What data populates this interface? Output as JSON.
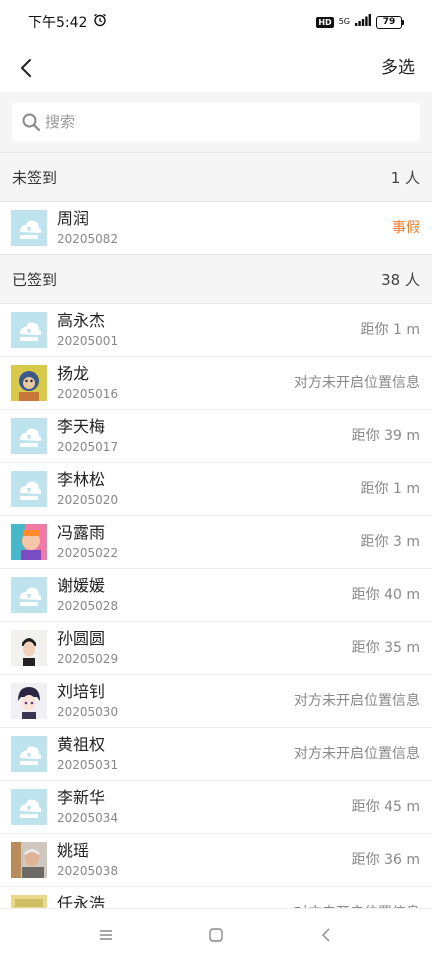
{
  "status_bar": {
    "time": "下午5:42",
    "network": "5G",
    "hd": "HD",
    "battery": "79"
  },
  "nav": {
    "action_label": "多选"
  },
  "search": {
    "placeholder": "搜索"
  },
  "sections": [
    {
      "title": "未签到",
      "count": "1 人",
      "students": [
        {
          "name": "周润",
          "id": "20205082",
          "status": "事假",
          "avatar": "default-cloud-avatar",
          "status_color": "#f07b2c"
        }
      ]
    },
    {
      "title": "已签到",
      "count": "38 人",
      "students": [
        {
          "name": "高永杰",
          "id": "20205001",
          "status": "距你 1 m",
          "avatar": "default-cloud-avatar"
        },
        {
          "name": "扬龙",
          "id": "20205016",
          "status": "对方未开启位置信息",
          "avatar": "monkey-photo-avatar"
        },
        {
          "name": "李天梅",
          "id": "20205017",
          "status": "距你 39 m",
          "avatar": "default-cloud-avatar"
        },
        {
          "name": "李林松",
          "id": "20205020",
          "status": "距你 1 m",
          "avatar": "default-cloud-avatar"
        },
        {
          "name": "冯露雨",
          "id": "20205022",
          "status": "距你 3 m",
          "avatar": "colorful-portrait-avatar"
        },
        {
          "name": "谢媛媛",
          "id": "20205028",
          "status": "距你 40 m",
          "avatar": "default-cloud-avatar"
        },
        {
          "name": "孙圆圆",
          "id": "20205029",
          "status": "距你 35 m",
          "avatar": "man-portrait-avatar"
        },
        {
          "name": "刘培钊",
          "id": "20205030",
          "status": "对方未开启位置信息",
          "avatar": "anime-boy-avatar"
        },
        {
          "name": "黄祖权",
          "id": "20205031",
          "status": "对方未开启位置信息",
          "avatar": "default-cloud-avatar"
        },
        {
          "name": "李新华",
          "id": "20205034",
          "status": "距你 45 m",
          "avatar": "default-cloud-avatar"
        },
        {
          "name": "姚瑶",
          "id": "20205038",
          "status": "距你 36 m",
          "avatar": "elder-photo-avatar"
        },
        {
          "name": "任永浩",
          "id": "",
          "status": "对方未开启位置信息",
          "avatar": "yellow-photo-avatar"
        }
      ]
    }
  ]
}
